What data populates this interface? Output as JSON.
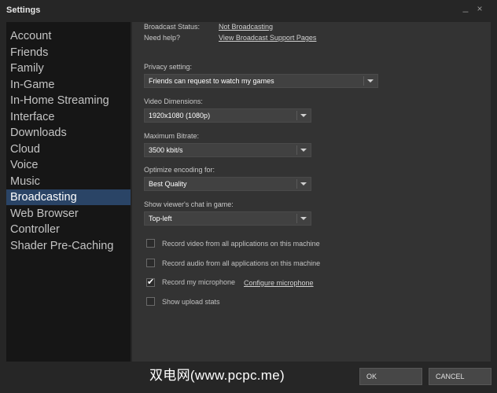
{
  "window": {
    "title": "Settings",
    "minimize_glyph": "_",
    "close_glyph": "×"
  },
  "sidebar": {
    "items": [
      {
        "label": "Account"
      },
      {
        "label": "Friends"
      },
      {
        "label": "Family"
      },
      {
        "label": "In-Game"
      },
      {
        "label": "In-Home Streaming"
      },
      {
        "label": "Interface"
      },
      {
        "label": "Downloads"
      },
      {
        "label": "Cloud"
      },
      {
        "label": "Voice"
      },
      {
        "label": "Music"
      },
      {
        "label": "Broadcasting"
      },
      {
        "label": "Web Browser"
      },
      {
        "label": "Controller"
      },
      {
        "label": "Shader Pre-Caching"
      }
    ],
    "active": "Broadcasting"
  },
  "broadcast": {
    "status_label": "Broadcast Status:",
    "status_value": "Not Broadcasting",
    "help_label": "Need help?",
    "help_link": "View Broadcast Support Pages"
  },
  "settings": {
    "privacy": {
      "label": "Privacy setting:",
      "value": "Friends can request to watch my games"
    },
    "dimensions": {
      "label": "Video Dimensions:",
      "value": "1920x1080 (1080p)"
    },
    "bitrate": {
      "label": "Maximum Bitrate:",
      "value": "3500 kbit/s"
    },
    "encoding": {
      "label": "Optimize encoding for:",
      "value": "Best Quality"
    },
    "chat": {
      "label": "Show viewer's chat in game:",
      "value": "Top-left"
    }
  },
  "checkboxes": {
    "record_video": {
      "label": "Record video from all applications on this machine",
      "checked": false
    },
    "record_audio": {
      "label": "Record audio from all applications on this machine",
      "checked": false
    },
    "record_mic": {
      "label": "Record my microphone",
      "checked": true,
      "link": "Configure microphone"
    },
    "upload_stats": {
      "label": "Show upload stats",
      "checked": false
    },
    "check_glyph": "✔"
  },
  "footer": {
    "ok": "OK",
    "cancel": "CANCEL",
    "watermark": "双电网(www.pcpc.me)"
  },
  "colors": {
    "active_item": "#2a4466",
    "background": "#262626",
    "content_panel": "#333333"
  }
}
